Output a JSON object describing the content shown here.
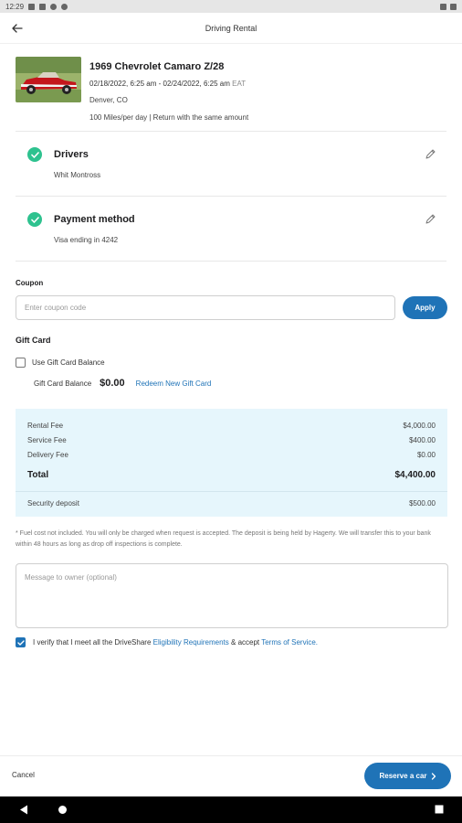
{
  "status_bar": {
    "time": "12:29"
  },
  "header": {
    "title": "Driving Rental"
  },
  "car": {
    "name": "1969 Chevrolet Camaro Z/28",
    "dates": "02/18/2022, 6:25 am - 02/24/2022, 6:25 am",
    "timezone": "EAT",
    "location": "Denver, CO",
    "mileage": "100 Miles/per day | Return with the same amount"
  },
  "drivers": {
    "title": "Drivers",
    "value": "Whit Montross"
  },
  "payment": {
    "title": "Payment method",
    "value": "Visa ending in 4242"
  },
  "coupon": {
    "label": "Coupon",
    "placeholder": "Enter coupon code",
    "apply_label": "Apply"
  },
  "gift_card": {
    "label": "Gift Card",
    "use_balance_label": "Use Gift Card Balance",
    "balance_label": "Gift Card Balance",
    "balance_value": "$0.00",
    "redeem_label": "Redeem New Gift Card"
  },
  "fees": {
    "rows": [
      {
        "label": "Rental Fee",
        "value": "$4,000.00"
      },
      {
        "label": "Service Fee",
        "value": "$400.00"
      },
      {
        "label": "Delivery Fee",
        "value": "$0.00"
      }
    ],
    "total_label": "Total",
    "total_value": "$4,400.00",
    "deposit_label": "Security deposit",
    "deposit_value": "$500.00"
  },
  "note": "* Fuel cost not included. You will only be charged when request is accepted. The deposit is being held by Hagerty. We will transfer this to your bank within 48 hours as long as drop off inspections is complete.",
  "message": {
    "placeholder": "Message to owner (optional)"
  },
  "verify": {
    "prefix": "I verify that I meet all the DriveShare",
    "eligibility_link": "Eligibility Requirements",
    "middle": "& accept",
    "terms_link": "Terms of Service."
  },
  "bottom": {
    "cancel_label": "Cancel",
    "reserve_label": "Reserve a car"
  },
  "colors": {
    "accent": "#1f73b7",
    "success": "#2ec28f",
    "fees_bg": "#e6f6fc"
  }
}
